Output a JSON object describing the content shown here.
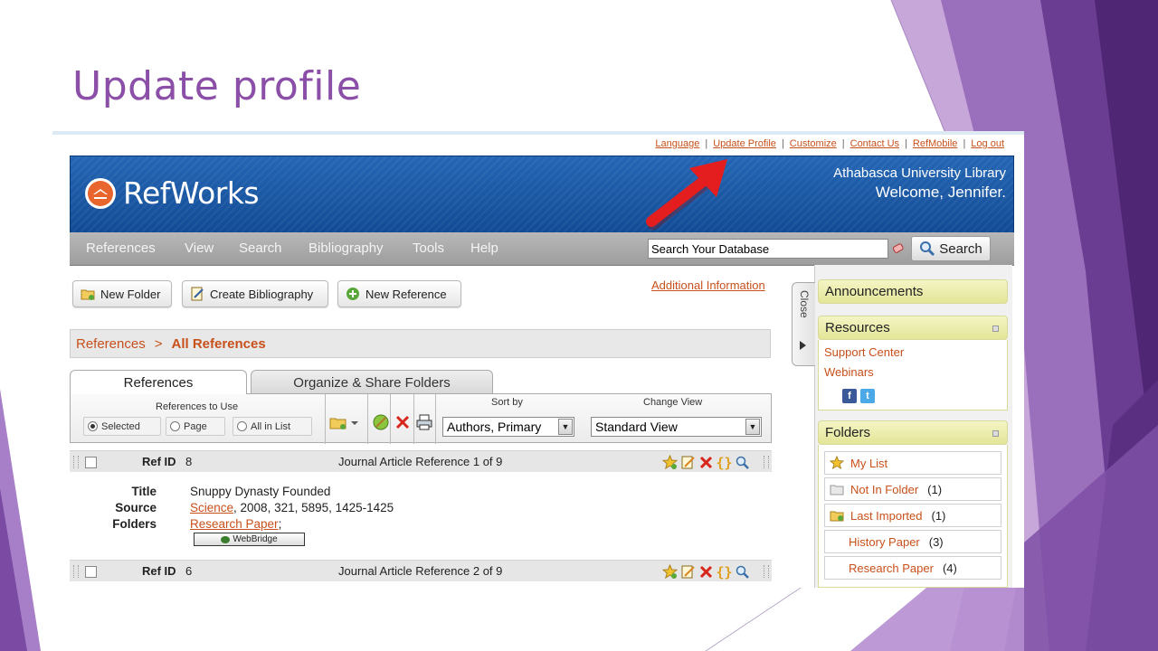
{
  "slide": {
    "title": "Update profile"
  },
  "top_links": {
    "language": "Language",
    "update_profile": "Update Profile",
    "customize": "Customize",
    "contact_us": "Contact Us",
    "refmobile": "RefMobile",
    "log_out": "Log out"
  },
  "header": {
    "logo_text": "RefWorks",
    "institution": "Athabasca University Library",
    "welcome": "Welcome, Jennifer."
  },
  "nav": {
    "items": [
      "References",
      "View",
      "Search",
      "Bibliography",
      "Tools",
      "Help"
    ],
    "search_placeholder": "Search Your Database",
    "search_button": "Search"
  },
  "toolbar": {
    "new_folder": "New Folder",
    "create_bibliography": "Create Bibliography",
    "new_reference": "New Reference",
    "additional_info": "Additional Information"
  },
  "breadcrumb": {
    "parent": "References",
    "separator": ">",
    "current": "All References"
  },
  "tabs": {
    "references": "References",
    "organize": "Organize & Share Folders"
  },
  "options": {
    "references_to_use_label": "References to Use",
    "selected": "Selected",
    "page": "Page",
    "all_in_list": "All in List",
    "sort_by_label": "Sort by",
    "sort_by_value": "Authors, Primary",
    "change_view_label": "Change View",
    "change_view_value": "Standard View"
  },
  "references": [
    {
      "ref_id_label": "Ref ID",
      "ref_id": "8",
      "description": "Journal Article Reference 1 of 9",
      "title_label": "Title",
      "title": "Snuppy Dynasty Founded",
      "source_label": "Source",
      "source_journal": "Science",
      "source_rest": ", 2008, 321, 5895, 1425-1425",
      "folders_label": "Folders",
      "folder": "Research Paper",
      "folder_suffix": ";",
      "webbridge": "WebBridge"
    },
    {
      "ref_id_label": "Ref ID",
      "ref_id": "6",
      "description": "Journal Article Reference 2 of 9"
    }
  ],
  "sidebar": {
    "close_label": "Close",
    "announcements": "Announcements",
    "resources": "Resources",
    "resource_links": [
      "Support Center",
      "Webinars"
    ],
    "folders_header": "Folders",
    "folders": [
      {
        "name": "My List",
        "count": ""
      },
      {
        "name": "Not In Folder",
        "count": "(1)"
      },
      {
        "name": "Last Imported",
        "count": "(1)"
      },
      {
        "name": "History Paper",
        "count": "(3)"
      },
      {
        "name": "Research Paper",
        "count": "(4)"
      }
    ]
  },
  "colors": {
    "title_purple": "#8b4fa8",
    "link_orange": "#c8501a",
    "header_blue": "#1a5aa8",
    "panel_yellow": "#e9eba8",
    "arrow_red": "#e41e1e"
  }
}
